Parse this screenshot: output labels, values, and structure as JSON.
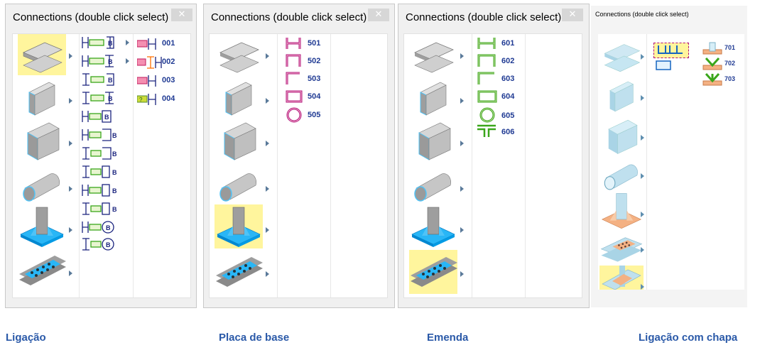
{
  "window_title": "Connections (double click select)",
  "close_glyph": "✕",
  "windows": [
    {
      "caption": "Ligação",
      "families": [
        "i-beam-icon",
        "channel-icon",
        "rect-tube-icon",
        "pipe-icon",
        "base-plate-icon",
        "bolted-plate-icon"
      ],
      "selected_family": 0,
      "numbers": [
        "001",
        "002",
        "003",
        "004"
      ]
    },
    {
      "caption": "Placa de base",
      "families": [
        "i-beam-icon",
        "channel-icon",
        "rect-tube-icon",
        "pipe-icon",
        "base-plate-icon",
        "bolted-plate-icon"
      ],
      "selected_family": 4,
      "numbers": [
        "501",
        "502",
        "503",
        "504",
        "505"
      ]
    },
    {
      "caption": "Emenda",
      "families": [
        "i-beam-icon",
        "channel-icon",
        "rect-tube-icon",
        "pipe-icon",
        "base-plate-icon",
        "bolted-plate-icon"
      ],
      "selected_family": 5,
      "numbers": [
        "601",
        "602",
        "603",
        "604",
        "605",
        "606"
      ]
    },
    {
      "caption": "Ligação com chapa",
      "families": [
        "i-beam-icon",
        "channel-icon",
        "rect-tube-icon",
        "pipe-icon",
        "base-plate-icon",
        "bolted-plate-icon",
        "gusset-joint-icon"
      ],
      "selected_family": 6,
      "numbers": [
        "701",
        "702",
        "703"
      ]
    }
  ],
  "colors": {
    "selected_bg": "#fff59d",
    "number_text": "#1f3a93",
    "caption_text": "#2a59a8",
    "profile_blue": "#1a237e",
    "profile_magenta": "#b0107a",
    "profile_green": "#3aa61a",
    "steel_gray": "#b9b9b9",
    "base_blue": "#29b6f6",
    "light_blue": "#b3e0f2"
  }
}
